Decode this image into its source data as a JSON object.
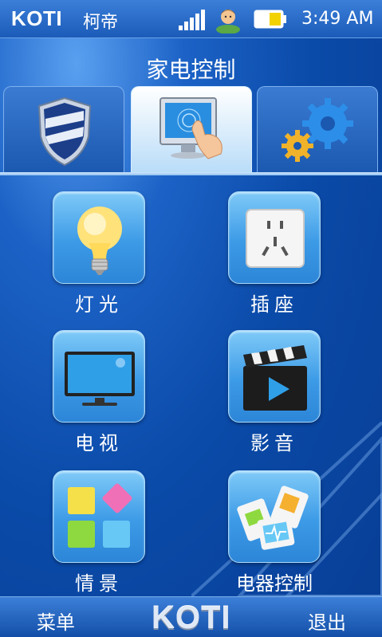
{
  "status_bar": {
    "brand": "KOTI",
    "brand_cn": "柯帝",
    "time": "3:49 AM"
  },
  "header": {
    "title": "家电控制"
  },
  "tabs": [
    {
      "icon": "shield-icon",
      "active": false
    },
    {
      "icon": "touch-screen-icon",
      "active": true
    },
    {
      "icon": "gears-icon",
      "active": false
    }
  ],
  "apps": [
    {
      "label": "灯光",
      "icon": "light-bulb-icon"
    },
    {
      "label": "插座",
      "icon": "power-socket-icon"
    },
    {
      "label": "电视",
      "icon": "television-icon"
    },
    {
      "label": "影音",
      "icon": "clapperboard-icon"
    },
    {
      "label": "情景",
      "icon": "scene-tiles-icon"
    },
    {
      "label": "电器控制",
      "icon": "appliance-cards-icon"
    }
  ],
  "bottom_bar": {
    "menu_label": "菜单",
    "logo": "KOTI",
    "exit_label": "退出"
  }
}
